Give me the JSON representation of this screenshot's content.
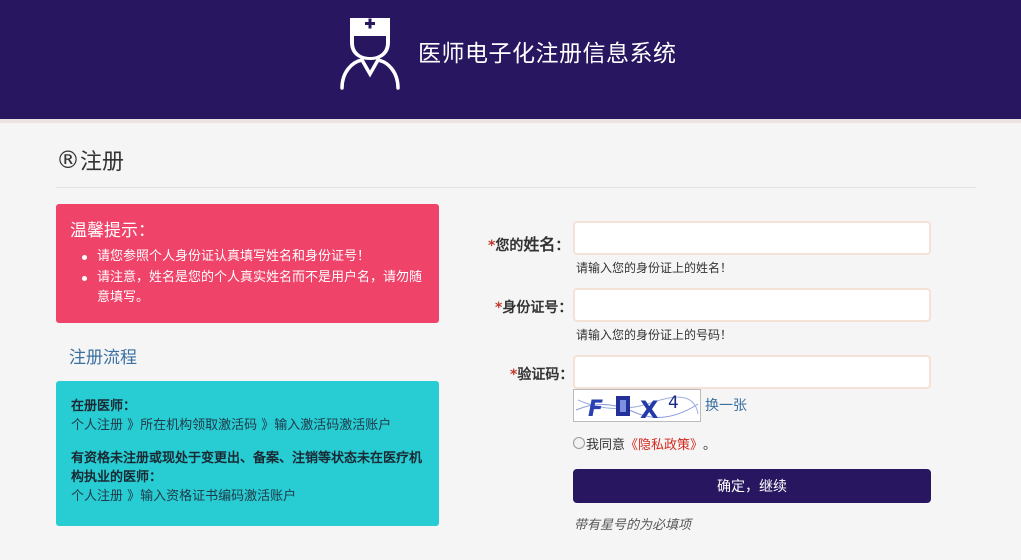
{
  "header": {
    "title": "医师电子化注册信息系统",
    "logo_icon": "doctor-nurse-icon",
    "bg_color": "#281760"
  },
  "page": {
    "title_mark": "®",
    "title": "注册"
  },
  "tips": {
    "title": "温馨提示：",
    "items": [
      "请您参照个人身份证认真填写姓名和身份证号！",
      "请注意，姓名是您的个人真实姓名而不是用户名，请勿随意填写。"
    ],
    "bg_color": "#ef4369"
  },
  "flow": {
    "title": "注册流程",
    "sections": [
      {
        "heading": "在册医师：",
        "steps": "个人注册 》所在机构领取激活码 》输入激活码激活账户"
      },
      {
        "heading": "有资格未注册或现处于变更出、备案、注销等状态未在医疗机构执业的医师：",
        "steps": "个人注册 》输入资格证书编码激活账户"
      }
    ],
    "bg_color": "#27cdd2"
  },
  "form": {
    "name": {
      "star": "*",
      "label_a": "您的",
      "label_b": "姓名",
      "colon": "：",
      "value": "",
      "hint": "请输入您的身份证上的姓名！"
    },
    "id": {
      "star": "*",
      "label": "身份证号：",
      "value": "",
      "hint": "请输入您的身份证上的号码！"
    },
    "captcha": {
      "star": "*",
      "label": "验证码：",
      "value": "",
      "image_text": "FUX4",
      "change_label": "换一张"
    },
    "agree": {
      "prefix": "我同意",
      "link": "《隐私政策》",
      "suffix": "。"
    },
    "submit_label": "确定，继续",
    "required_note": "带有星号的为必填项"
  }
}
